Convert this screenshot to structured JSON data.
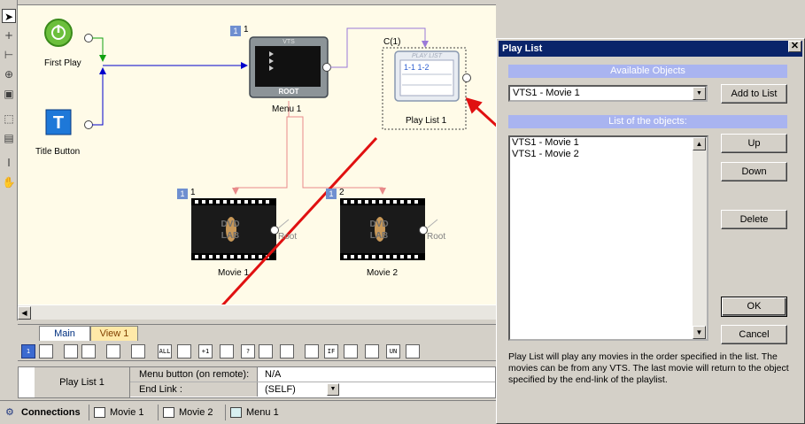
{
  "canvas": {
    "nodes": {
      "first_play": {
        "label": "First Play"
      },
      "title_button": {
        "label": "Title Button"
      },
      "menu": {
        "label": "Menu 1",
        "badge": "1",
        "num": "1",
        "header": "VTS",
        "footer": "ROOT"
      },
      "playlist": {
        "label": "Play List 1",
        "corner": "C(1)",
        "header": "PLAY LIST",
        "content": "1-1 1-2"
      },
      "movie1": {
        "label": "Movie 1",
        "badge": "1",
        "num": "1",
        "root": "Root"
      },
      "movie2": {
        "label": "Movie 2",
        "badge": "1",
        "num": "2",
        "root": "Root"
      }
    },
    "film_art": [
      "DVD",
      "LAB"
    ]
  },
  "tabs": [
    {
      "label": "Main",
      "active": true
    },
    {
      "label": "View 1",
      "active": false
    }
  ],
  "icon_toolbar": [
    {
      "icon": "number-one-icon",
      "text": "1"
    },
    {
      "icon": "frame-icon",
      "text": ""
    },
    {
      "icon": "menu-icon",
      "text": ""
    },
    {
      "icon": "list-icon",
      "text": ""
    },
    {
      "icon": "tree-icon",
      "text": ""
    },
    {
      "icon": "image-icon",
      "text": ""
    },
    {
      "icon": "all-icon",
      "text": "ALL"
    },
    {
      "icon": "playlist-icon",
      "text": ""
    },
    {
      "icon": "plus-one-icon",
      "text": "+1"
    },
    {
      "icon": "dice-icon",
      "text": ""
    },
    {
      "icon": "question-icon",
      "text": "?"
    },
    {
      "icon": "chapter-icon",
      "text": ""
    },
    {
      "icon": "stack-icon",
      "text": ""
    },
    {
      "icon": "link-icon",
      "text": ""
    },
    {
      "icon": "if-icon",
      "text": "IF"
    },
    {
      "icon": "play-icon",
      "text": ""
    },
    {
      "icon": "jump-icon",
      "text": ""
    },
    {
      "icon": "un-icon",
      "text": "UN"
    },
    {
      "icon": "split-icon",
      "text": ""
    }
  ],
  "properties": {
    "selected": "Play List 1",
    "rows": [
      {
        "key": "Menu button (on remote):",
        "value": "N/A"
      },
      {
        "key": "End Link :",
        "value": "(SELF)"
      }
    ]
  },
  "window_tabs": [
    {
      "label": "Connections",
      "icon": "connections-icon",
      "active": true
    },
    {
      "label": "Movie 1",
      "icon": "movie-window-icon",
      "active": false
    },
    {
      "label": "Movie 2",
      "icon": "movie-window-icon",
      "active": false
    },
    {
      "label": "Menu 1",
      "icon": "menu-window-icon",
      "active": false
    }
  ],
  "dialog": {
    "title": "Play List",
    "close": "✕",
    "available_header": "Available Objects",
    "selected_object": "VTS1 - Movie 1",
    "add_button": "Add to List",
    "list_header": "List of the objects:",
    "list_items": [
      "VTS1 - Movie 1",
      "VTS1 - Movie 2"
    ],
    "up_button": "Up",
    "down_button": "Down",
    "delete_button": "Delete",
    "ok_button": "OK",
    "cancel_button": "Cancel",
    "description": "Play List will play any movies in the order specified in the list. The movies can be from any VTS. The last movie will return to the object specified by the end-link of the playlist."
  },
  "colors": {
    "canvas_bg": "#fffbe8",
    "connector_blue": "#0000cc",
    "connector_pink": "#e88a8a",
    "connector_purple": "#9a7ad8",
    "annotation_red": "#e01010",
    "dialog_title": "#0a246a",
    "section_header": "#a9b4f0",
    "badge_blue": "#6f8fd0"
  }
}
